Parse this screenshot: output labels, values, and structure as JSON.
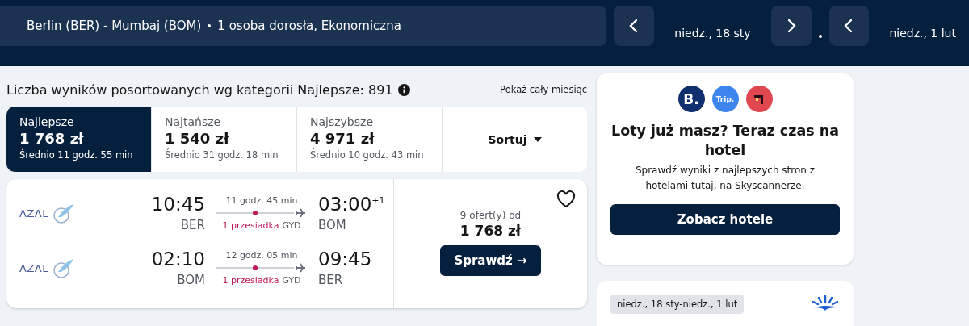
{
  "header": {
    "route": "Berlin (BER) - Mumbaj (BOM)",
    "passengers": "1 osoba dorosła, Ekonomiczna",
    "depart_date": "niedz., 18 sty",
    "return_date": "niedz., 1 lut"
  },
  "summary": {
    "text": "Liczba wyników posortowanych wg kategorii Najlepsze: 891",
    "link": "Pokaż cały miesiąc"
  },
  "sort_tabs": [
    {
      "label": "Najlepsze",
      "price": "1 768 zł",
      "avg": "Średnio 11 godz. 55 min",
      "selected": true
    },
    {
      "label": "Najtańsze",
      "price": "1 540 zł",
      "avg": "Średnio 31 godz. 18 min",
      "selected": false
    },
    {
      "label": "Najszybsze",
      "price": "4 971 zł",
      "avg": "Średnio 10 godz. 43 min",
      "selected": false
    }
  ],
  "sort_button": "Sortuj",
  "flight": {
    "legs": [
      {
        "airline": "AZAL",
        "dep_time": "10:45",
        "dep_code": "BER",
        "duration": "11 godz. 45 min",
        "stops": "1 przesiadka",
        "via": "GYD",
        "arr_time": "03:00",
        "day_offset": "+1",
        "arr_code": "BOM"
      },
      {
        "airline": "AZAL",
        "dep_time": "02:10",
        "dep_code": "BOM",
        "duration": "12 godz. 05 min",
        "stops": "1 przesiadka",
        "via": "GYD",
        "arr_time": "09:45",
        "arr_code": "BER"
      }
    ],
    "favorite": false,
    "offers": "9 ofert(y) od",
    "price": "1 768 zł",
    "button": "Sprawdź →"
  },
  "hotel_promo": {
    "partners": [
      {
        "kind": "booking",
        "label": "B.",
        "color": "#0f2f6e"
      },
      {
        "kind": "trip",
        "label": "Trip.",
        "color": "#3e84ee"
      },
      {
        "kind": "icon",
        "color": "#e0474f"
      }
    ],
    "title": "Loty już masz? Teraz czas na hotel",
    "text": "Sprawdź wyniki z najlepszych stron z hotelami tutaj, na Skyscannerze.",
    "button": "Zobacz hotele"
  },
  "deal_card": {
    "dates": "niedz., 18 sty-niedz., 1 lut"
  }
}
